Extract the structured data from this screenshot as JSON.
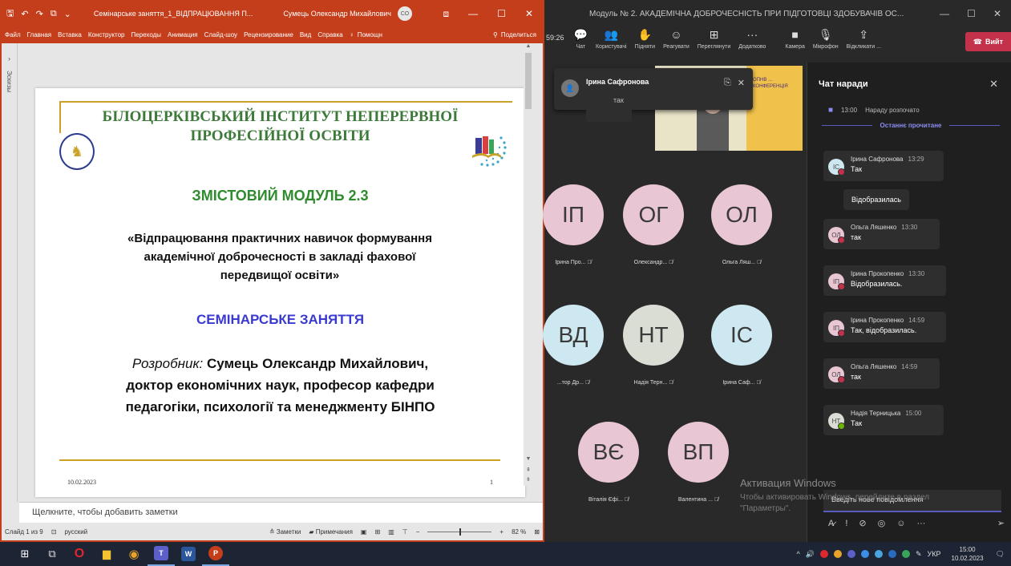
{
  "ppt": {
    "qat": [
      "🖫",
      "↶",
      "↷",
      "⧉",
      "⌄"
    ],
    "title": "Семінарське заняття_1_ВІДПРАЦЮВАННЯ П...",
    "user": "Сумець Олександр Михайлович",
    "user_initials": "CO",
    "window_controls": [
      "⧈",
      "—",
      "☐",
      "✕"
    ],
    "ribbon_tabs": [
      "Файл",
      "Главная",
      "Вставка",
      "Конструктор",
      "Переходы",
      "Анимация",
      "Слайд-шоу",
      "Рецензирование",
      "Вид",
      "Справка"
    ],
    "help_icon": "lightbulb-icon",
    "help_label": "Помощн",
    "share_label": "Поделиться",
    "thumb_pane_label": "Эскизы",
    "slide": {
      "institute_line1": "БІЛОЦЕРКІВСЬКИЙ ІНСТИТУТ НЕПЕРЕРВНОЇ",
      "institute_line2": "ПРОФЕСІЙНОЇ ОСВІТИ",
      "module": "ЗМІСТОВИЙ МОДУЛЬ 2.3",
      "topic_line1": "«Відпрацювання практичних навичок  формування",
      "topic_line2": "академічної доброчесності в закладі фахової",
      "topic_line3": "передвищої освіти»",
      "seminar": "СЕМІНАРСЬКЕ ЗАНЯТТЯ",
      "author_label": "Розробник:",
      "author_name": " Сумець Олександр Михайлович,",
      "author_line2": "доктор економічних наук, професор кафедри",
      "author_line3": "педагогіки, психології та менеджменту БІНПО",
      "date": "10.02.2023",
      "number": "1"
    },
    "notes_placeholder": "Щелкните, чтобы добавить заметки",
    "status": {
      "slide_info": "Слайд 1 из 9",
      "language": "русский",
      "notes_btn": "Заметки",
      "comments_btn": "Примечания",
      "zoom": "82 %"
    }
  },
  "teams": {
    "title": "Модуль № 2. АКАДЕМІЧНА ДОБРОЧЕСНІСТЬ ПРИ ПІДГОТОВЦІ ЗДОБУВАЧІВ ОС...",
    "timer": "59:26",
    "toolbar": [
      {
        "icon": "chat-icon",
        "glyph": "💬",
        "label": "Чат"
      },
      {
        "icon": "people-icon",
        "glyph": "👥",
        "label": "Користувачі"
      },
      {
        "icon": "raise-hand-icon",
        "glyph": "✋",
        "label": "Підняти"
      },
      {
        "icon": "react-icon",
        "glyph": "☺",
        "label": "Реагувати"
      },
      {
        "icon": "view-icon",
        "glyph": "⊞",
        "label": "Переглянути"
      },
      {
        "icon": "more-icon",
        "glyph": "···",
        "label": "Додатково"
      },
      {
        "icon": "camera-icon",
        "glyph": "■",
        "label": "Камера"
      },
      {
        "icon": "mic-icon",
        "glyph": "🎙",
        "label": "Мікрофон"
      },
      {
        "icon": "share-icon",
        "glyph": "⇪",
        "label": "Відкликати ..."
      }
    ],
    "leave_label": "Вийт",
    "toast": {
      "initials": "",
      "name": "Ірина Сафронова",
      "message": "так"
    },
    "video_text": "ОПНВ ... КОНФЕРЕНЦІЯ",
    "tiles": [
      {
        "initials": "ІП",
        "name": "Ірина Про...",
        "color": "c-pink"
      },
      {
        "initials": "ОГ",
        "name": "Олександр...",
        "color": "c-pink"
      },
      {
        "initials": "ОЛ",
        "name": "Ольга Ляш...",
        "color": "c-pink"
      },
      {
        "initials": "ВД",
        "name": "...тор Др...",
        "color": "c-blue"
      },
      {
        "initials": "НТ",
        "name": "Надія Терн...",
        "color": "c-gray"
      },
      {
        "initials": "ІС",
        "name": "Ірина Саф...",
        "color": "c-blue"
      },
      {
        "initials": "ВЄ",
        "name": "Віталія Єфі...",
        "color": "c-pink"
      },
      {
        "initials": "ВП",
        "name": "Валентина ...",
        "color": "c-pink"
      }
    ],
    "watermark_title": "Активация Windows",
    "watermark_text": "Чтобы активировать Windows, перейдите в раздел \"Параметры\".",
    "chat": {
      "title": "Чат наради",
      "system_time": "13:00",
      "system_text": "Нараду розпочато",
      "divider": "Останнє прочитане",
      "messages": [
        {
          "initials": "ІС",
          "name": "Ірина Сафронова",
          "time": "13:29",
          "text": "Так",
          "color": "#cde8f0"
        },
        {
          "initials": "ОЛ",
          "name": "Ольга Ляшенко",
          "time": "13:30",
          "text": "так",
          "color": "#e8c6d3"
        },
        {
          "initials": "ІП",
          "name": "Ірина Прокопенко",
          "time": "13:30",
          "text": "Відобразилась.",
          "color": "#e8c6d3"
        },
        {
          "initials": "ІП",
          "name": "Ірина Прокопенко",
          "time": "14:59",
          "text": "Так, відобразилась.",
          "color": "#e8c6d3"
        },
        {
          "initials": "ОЛ",
          "name": "Ольга Ляшенко",
          "time": "14:59",
          "text": "так",
          "color": "#e8c6d3"
        },
        {
          "initials": "НТ",
          "name": "Надія Терницька",
          "time": "15:00",
          "text": "Так",
          "color": "#d9ddd4"
        }
      ],
      "continuation": "Відобразилась",
      "compose_placeholder": "Введіть нове повідомлення"
    }
  },
  "taskbar": {
    "apps": [
      {
        "name": "start-icon",
        "glyph": "⊞",
        "color": "#ffffff"
      },
      {
        "name": "task-view-icon",
        "glyph": "⧉",
        "color": "#dddddd"
      },
      {
        "name": "opera-icon",
        "glyph": "O",
        "color": "#e0262e"
      },
      {
        "name": "file-explorer-icon",
        "glyph": "▆",
        "color": "#f2c230"
      },
      {
        "name": "chrome-icon",
        "glyph": "◉",
        "color": "#e8a42a"
      },
      {
        "name": "teams-icon",
        "glyph": "T",
        "color": "#5b5fc7"
      },
      {
        "name": "word-icon",
        "glyph": "W",
        "color": "#2b579a"
      },
      {
        "name": "powerpoint-icon",
        "glyph": "P",
        "color": "#c43e1c"
      }
    ],
    "language": "УКР",
    "time": "15:00",
    "date": "10.02.2023"
  }
}
